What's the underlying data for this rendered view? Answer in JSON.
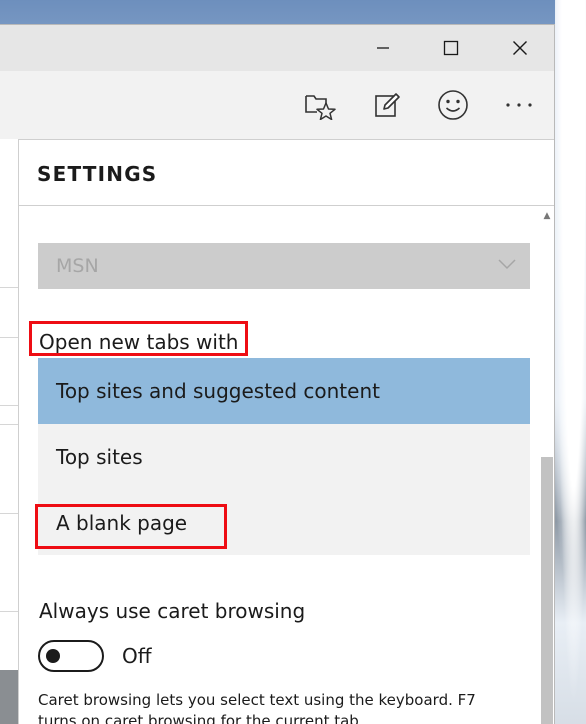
{
  "settings": {
    "title": "SETTINGS",
    "home_select": {
      "value": "MSN"
    },
    "open_new_tabs": {
      "label": "Open new tabs with",
      "options": [
        {
          "label": "Top sites and suggested content",
          "selected": true
        },
        {
          "label": "Top sites",
          "selected": false
        },
        {
          "label": "A blank page",
          "selected": false
        }
      ]
    },
    "caret_browsing": {
      "label": "Always use caret browsing",
      "state": "Off",
      "description": "Caret browsing lets you select text using the keyboard. F7 turns on caret browsing for the current tab."
    }
  },
  "colors": {
    "selected_option": "#8fb9dc",
    "highlight_box": "#ee0d14",
    "pane_background": "#ffffff",
    "chrome_background": "#f2f2f2"
  },
  "icons": {
    "minimize": "minimize-icon",
    "maximize": "maximize-icon",
    "close": "close-icon",
    "hub": "favorites-hub-icon",
    "web_note": "web-note-icon",
    "feedback": "smiley-feedback-icon",
    "more": "more-icon"
  }
}
